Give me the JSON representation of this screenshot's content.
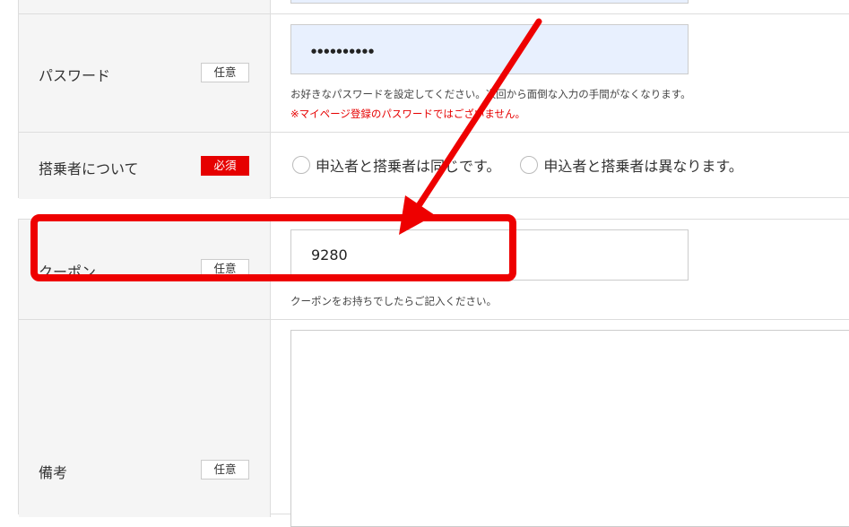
{
  "password": {
    "label": "パスワード",
    "badge": "任意",
    "value": "●●●●●●●●●●",
    "note": "お好きなパスワードを設定してください。次回から面倒な入力の手間がなくなります。",
    "warning": "※マイページ登録のパスワードではございません。"
  },
  "passenger": {
    "label": "搭乗者について",
    "badge": "必須",
    "options": [
      "申込者と搭乗者は同じです。",
      "申込者と搭乗者は異なります。"
    ]
  },
  "coupon": {
    "label": "クーポン",
    "badge": "任意",
    "value": "9280",
    "note": "クーポンをお持ちでしたらご記入ください。"
  },
  "remarks": {
    "label": "備考",
    "badge": "任意",
    "value": ""
  },
  "colors": {
    "required": "#e60000",
    "annotation": "#ee0000",
    "autofill": "#e8f0fe"
  }
}
